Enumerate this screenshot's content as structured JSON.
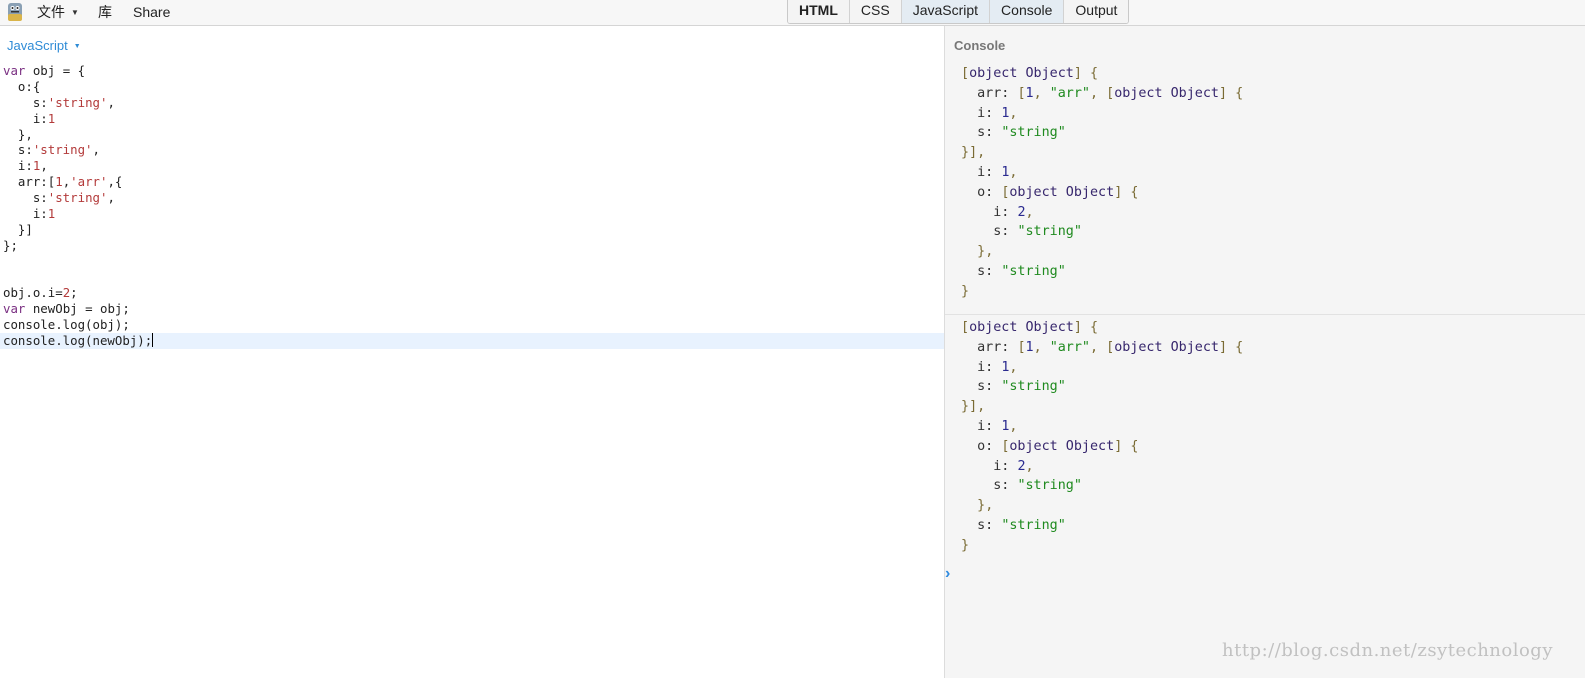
{
  "menubar": {
    "file_label": "文件",
    "library_label": "库",
    "share_label": "Share"
  },
  "tabs": [
    {
      "label": "HTML",
      "bold": true,
      "active": false
    },
    {
      "label": "CSS",
      "bold": false,
      "active": false
    },
    {
      "label": "JavaScript",
      "bold": false,
      "active": true
    },
    {
      "label": "Console",
      "bold": false,
      "active": true
    },
    {
      "label": "Output",
      "bold": false,
      "active": false
    }
  ],
  "editor": {
    "language_label": "JavaScript",
    "code_lines": [
      "var obj = {",
      "  o:{",
      "    s:'string',",
      "    i:1",
      "  },",
      "  s:'string',",
      "  i:1,",
      "  arr:[1,'arr',{",
      "    s:'string',",
      "    i:1",
      "  }]",
      "};",
      "",
      "",
      "obj.o.i=2;",
      "var newObj = obj;",
      "console.log(obj);",
      "console.log(newObj);"
    ],
    "current_line_index": 17
  },
  "console": {
    "title": "Console",
    "entries": [
      {
        "lines": [
          "[object Object] {",
          "  arr: [1, \"arr\", [object Object] {",
          "  i: 1,",
          "  s: \"string\"",
          "}],",
          "  i: 1,",
          "  o: [object Object] {",
          "    i: 2,",
          "    s: \"string\"",
          "  },",
          "  s: \"string\"",
          "}"
        ]
      },
      {
        "lines": [
          "[object Object] {",
          "  arr: [1, \"arr\", [object Object] {",
          "  i: 1,",
          "  s: \"string\"",
          "}],",
          "  i: 1,",
          "  o: [object Object] {",
          "    i: 2,",
          "    s: \"string\"",
          "  },",
          "  s: \"string\"",
          "}"
        ]
      }
    ],
    "prompt_symbol": "›"
  },
  "watermark": "http://blog.csdn.net/zsytechnology",
  "colors": {
    "accent_blue": "#2e8bd6",
    "keyword_purple": "#7a2f82",
    "string_red": "#b33a3a",
    "console_string_green": "#1f8a1f",
    "current_line_bg": "#e8f2fe"
  },
  "icons": {
    "logo": "jsbin-logo-icon",
    "file_caret": "caret-down-icon",
    "language_caret": "caret-down-icon",
    "prompt": "chevron-right-icon"
  }
}
